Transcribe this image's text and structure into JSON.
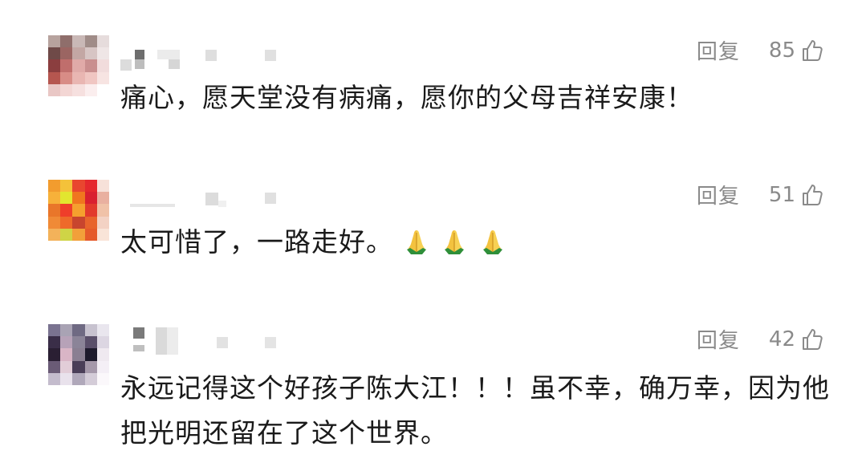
{
  "comments": [
    {
      "reply_label": "回复",
      "likes": "85",
      "text": "痛心，愿天堂没有病痛，愿你的父母吉祥安康！",
      "avatar_colors": [
        "#b7a39e",
        "#8f6e6b",
        "#c9b8b6",
        "#a08c88",
        "#e6dcdc",
        "#6f4a48",
        "#9b6562",
        "#c3a7a4",
        "#d7c5c4",
        "#efe6e6",
        "#8b3e3f",
        "#c06e6c",
        "#e0aaa8",
        "#c98f8f",
        "#f1dcdc",
        "#b5564f",
        "#d88c86",
        "#e9b6b2",
        "#f0c6c2",
        "#f7e4e2",
        "#e9c7c5",
        "#f3d6d4",
        "#f6e0df",
        "#fbeeee",
        "#ffffff"
      ]
    },
    {
      "reply_label": "回复",
      "likes": "51",
      "text": "太可惜了，一路走好。",
      "avatar_colors": [
        "#f29c2e",
        "#f4c23a",
        "#e9462f",
        "#e5282e",
        "#f7e1d9",
        "#f7b13a",
        "#e2e62f",
        "#f0761f",
        "#d9202f",
        "#e9b0a0",
        "#e9762a",
        "#ef3e2a",
        "#f5a02e",
        "#e23a2c",
        "#f0c2a8",
        "#f08a36",
        "#ee6a2a",
        "#c8452e",
        "#e8642c",
        "#f3d2c4",
        "#f3b25a",
        "#cfd446",
        "#f2a03a",
        "#e55a2a",
        "#f9e4d8"
      ]
    },
    {
      "reply_label": "回复",
      "likes": "42",
      "text": "永远记得这个好孩子陈大江！！！虽不幸，确万幸，因为他把光明还留在了这个世界。",
      "avatar_colors": [
        "#7a7390",
        "#a9a3b4",
        "#6f6a83",
        "#c7c2cf",
        "#e9e6ee",
        "#3a2e48",
        "#b7a2b8",
        "#8b8498",
        "#5a4f6a",
        "#dcd6e2",
        "#2a1f33",
        "#d9b5c6",
        "#8a7f92",
        "#1d1a2c",
        "#efe9f0",
        "#6a5b76",
        "#e2cdd8",
        "#4a3e58",
        "#a598aa",
        "#f4eff6",
        "#c4bccd",
        "#e9e2ec",
        "#b0a8ba",
        "#d4ccd8",
        "#fbf8fb"
      ]
    }
  ],
  "icons": {
    "like": "thumbs-up-outline",
    "emoji": "folded-hands"
  }
}
